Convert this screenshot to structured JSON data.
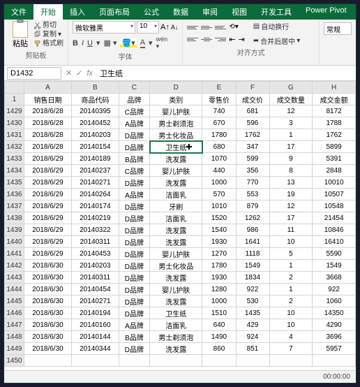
{
  "tabs": [
    "文件",
    "开始",
    "插入",
    "页面布局",
    "公式",
    "数据",
    "审阅",
    "视图",
    "开发工具",
    "Power Pivot"
  ],
  "activeTab": 1,
  "ribbon": {
    "clipboard": {
      "paste": "粘贴",
      "cut": "剪切",
      "copy": "复制",
      "formatPainter": "格式刷",
      "groupLabel": "剪贴板"
    },
    "font": {
      "name": "微软雅黑",
      "size": "10",
      "bold": "B",
      "italic": "I",
      "underline": "U",
      "groupLabel": "字体"
    },
    "align": {
      "wrap": "自动换行",
      "merge": "合并后居中",
      "groupLabel": "对齐方式"
    },
    "number": {
      "format": "常规"
    }
  },
  "nameBox": "D1432",
  "formula": "卫生纸",
  "colHeaders": [
    "A",
    "B",
    "C",
    "D",
    "E",
    "F",
    "G",
    "H"
  ],
  "headerRow": [
    "销售日期",
    "商品代码",
    "品牌",
    "类别",
    "零售价",
    "成交价",
    "成交数量",
    "成交金额"
  ],
  "selectedCell": {
    "row": 1432,
    "col": 3
  },
  "rows": [
    {
      "n": 1429,
      "c": [
        "2018/6/28",
        "20140395",
        "C品牌",
        "婴儿护肤",
        "740",
        "681",
        "12",
        "8172"
      ]
    },
    {
      "n": 1430,
      "c": [
        "2018/6/28",
        "20140452",
        "A品牌",
        "男士剃须泡",
        "670",
        "596",
        "3",
        "1788"
      ]
    },
    {
      "n": 1431,
      "c": [
        "2018/6/28",
        "20140203",
        "D品牌",
        "男士化妆品",
        "1780",
        "1762",
        "1",
        "1762"
      ]
    },
    {
      "n": 1432,
      "c": [
        "2018/6/28",
        "20140154",
        "D品牌",
        "卫生纸",
        "680",
        "347",
        "17",
        "5899"
      ]
    },
    {
      "n": 1433,
      "c": [
        "2018/6/29",
        "20140189",
        "B品牌",
        "洗发露",
        "1070",
        "599",
        "9",
        "5391"
      ]
    },
    {
      "n": 1434,
      "c": [
        "2018/6/29",
        "20140237",
        "C品牌",
        "婴儿护肤",
        "440",
        "356",
        "8",
        "2848"
      ]
    },
    {
      "n": 1435,
      "c": [
        "2018/6/29",
        "20140271",
        "D品牌",
        "洗发露",
        "1000",
        "770",
        "13",
        "10010"
      ]
    },
    {
      "n": 1436,
      "c": [
        "2018/6/29",
        "20140264",
        "A品牌",
        "洁面乳",
        "570",
        "553",
        "19",
        "10507"
      ]
    },
    {
      "n": 1437,
      "c": [
        "2018/6/29",
        "20140174",
        "D品牌",
        "牙刷",
        "1010",
        "879",
        "12",
        "10548"
      ]
    },
    {
      "n": 1438,
      "c": [
        "2018/6/29",
        "20140219",
        "D品牌",
        "洁面乳",
        "1520",
        "1262",
        "17",
        "21454"
      ]
    },
    {
      "n": 1439,
      "c": [
        "2018/6/29",
        "20140322",
        "D品牌",
        "洗发露",
        "1540",
        "986",
        "11",
        "10846"
      ]
    },
    {
      "n": 1440,
      "c": [
        "2018/6/29",
        "20140311",
        "D品牌",
        "洗发露",
        "1930",
        "1641",
        "10",
        "16410"
      ]
    },
    {
      "n": 1441,
      "c": [
        "2018/6/29",
        "20140453",
        "D品牌",
        "婴儿护肤",
        "1270",
        "1118",
        "5",
        "5590"
      ]
    },
    {
      "n": 1442,
      "c": [
        "2018/6/30",
        "20140203",
        "D品牌",
        "男士化妆品",
        "1780",
        "1549",
        "1",
        "1549"
      ]
    },
    {
      "n": 1443,
      "c": [
        "2018/6/30",
        "20140311",
        "D品牌",
        "洗发露",
        "1930",
        "1834",
        "2",
        "3668"
      ]
    },
    {
      "n": 1444,
      "c": [
        "2018/6/30",
        "20140454",
        "D品牌",
        "婴儿护肤",
        "1280",
        "922",
        "1",
        "922"
      ]
    },
    {
      "n": 1445,
      "c": [
        "2018/6/30",
        "20140271",
        "D品牌",
        "洗发露",
        "1000",
        "530",
        "2",
        "1060"
      ]
    },
    {
      "n": 1446,
      "c": [
        "2018/6/30",
        "20140194",
        "D品牌",
        "卫生纸",
        "1510",
        "1435",
        "10",
        "14350"
      ]
    },
    {
      "n": 1447,
      "c": [
        "2018/6/30",
        "20140160",
        "A品牌",
        "洁面乳",
        "640",
        "429",
        "10",
        "4290"
      ]
    },
    {
      "n": 1448,
      "c": [
        "2018/6/30",
        "20140144",
        "B品牌",
        "男士剃须泡",
        "1490",
        "924",
        "4",
        "3696"
      ]
    },
    {
      "n": 1449,
      "c": [
        "2018/6/30",
        "20140344",
        "D品牌",
        "洗发露",
        "860",
        "851",
        "7",
        "5957"
      ]
    },
    {
      "n": 1450,
      "c": [
        "",
        "",
        "",
        "",
        "",
        "",
        "",
        ""
      ]
    }
  ],
  "clock": "00:00:00",
  "chart_data": null
}
